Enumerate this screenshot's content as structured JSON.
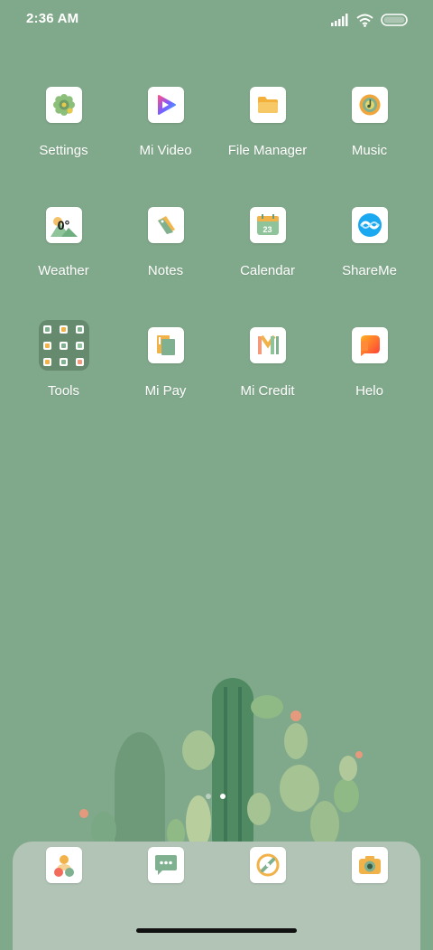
{
  "status_bar": {
    "time": "2:36 AM",
    "icons": [
      "signal-icon",
      "wifi-icon",
      "battery-icon"
    ]
  },
  "apps": [
    {
      "label": "Settings",
      "icon": "gear-icon"
    },
    {
      "label": "Mi Video",
      "icon": "play-icon"
    },
    {
      "label": "File Manager",
      "icon": "folder-icon"
    },
    {
      "label": "Music",
      "icon": "music-disc-icon"
    },
    {
      "label": "Weather",
      "icon": "weather-icon",
      "icon_text": "0°"
    },
    {
      "label": "Notes",
      "icon": "notes-icon"
    },
    {
      "label": "Calendar",
      "icon": "calendar-icon",
      "icon_text": "23"
    },
    {
      "label": "ShareMe",
      "icon": "shareme-icon"
    },
    {
      "label": "Tools",
      "icon": "folder-tools-icon"
    },
    {
      "label": "Mi Pay",
      "icon": "mi-pay-icon"
    },
    {
      "label": "Mi Credit",
      "icon": "mi-credit-icon"
    },
    {
      "label": "Helo",
      "icon": "helo-icon"
    }
  ],
  "page_indicator": {
    "pages": 2,
    "current": 2
  },
  "dock": [
    {
      "icon": "contacts-phone-icon"
    },
    {
      "icon": "messages-icon"
    },
    {
      "icon": "browser-icon"
    },
    {
      "icon": "camera-icon"
    }
  ],
  "colors": {
    "wallpaper": "#80a88a",
    "dock": "#b1c4b5",
    "accent_green": "#7fb08f",
    "accent_orange": "#f2a03c"
  }
}
